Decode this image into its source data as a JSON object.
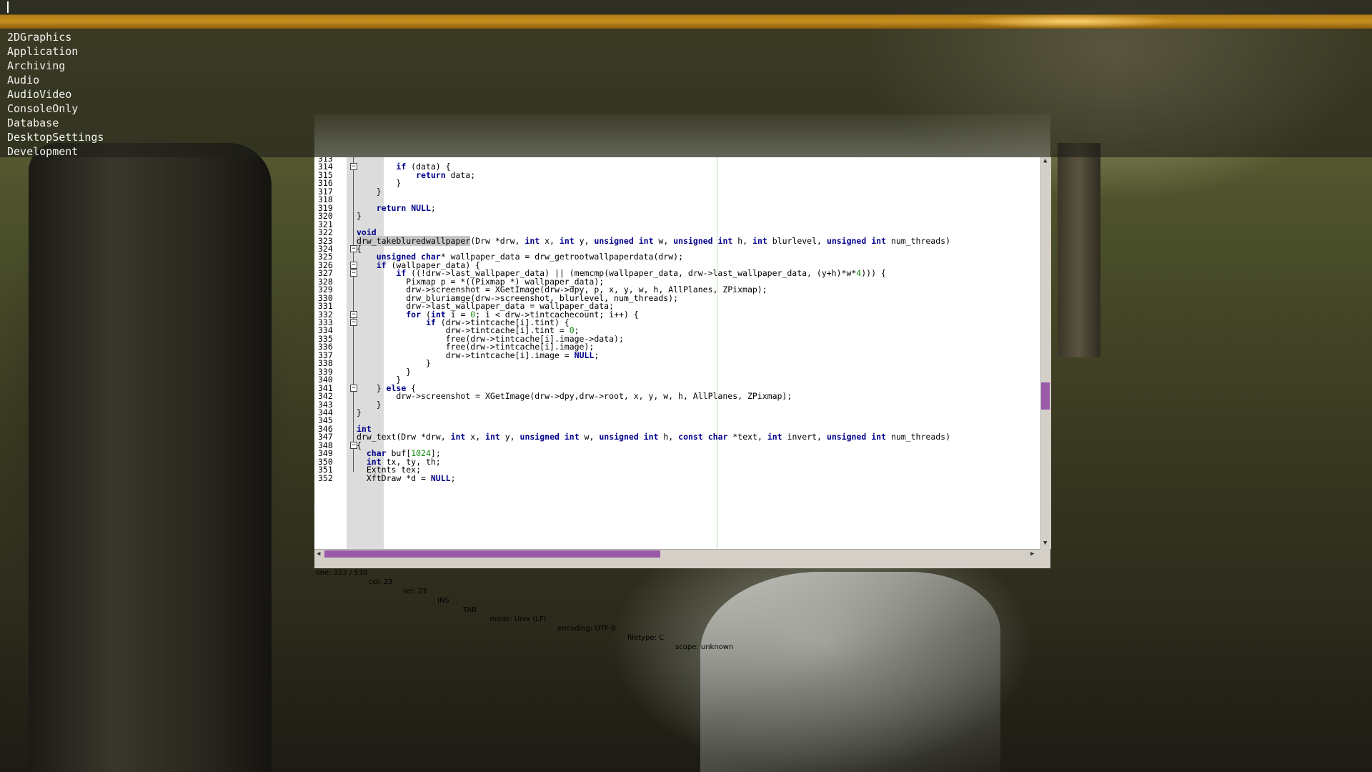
{
  "launcher": {
    "categories": [
      "2DGraphics",
      "Application",
      "Archiving",
      "Audio",
      "AudioVideo",
      "ConsoleOnly",
      "Database",
      "DesktopSettings",
      "Development"
    ]
  },
  "editor": {
    "lines": [
      {
        "n": "313",
        "t": ""
      },
      {
        "n": "314",
        "t": "        if (data) {"
      },
      {
        "n": "315",
        "t": "            return data;"
      },
      {
        "n": "316",
        "t": "        }"
      },
      {
        "n": "317",
        "t": "    }"
      },
      {
        "n": "318",
        "t": ""
      },
      {
        "n": "319",
        "t": "    return NULL;"
      },
      {
        "n": "320",
        "t": "}"
      },
      {
        "n": "321",
        "t": ""
      },
      {
        "n": "322",
        "t": "void"
      },
      {
        "n": "323",
        "t": "drw_takebluredwallpaper(Drw *drw, int x, int y, unsigned int w, unsigned int h, int blurlevel, unsigned int num_threads)"
      },
      {
        "n": "324",
        "t": "{"
      },
      {
        "n": "325",
        "t": "    unsigned char* wallpaper_data = drw_getrootwallpaperdata(drw);"
      },
      {
        "n": "326",
        "t": "    if (wallpaper_data) {"
      },
      {
        "n": "327",
        "t": "        if ((!drw->last_wallpaper_data) || (memcmp(wallpaper_data, drw->last_wallpaper_data, (y+h)*w*4))) {"
      },
      {
        "n": "328",
        "t": "          Pixmap p = *((Pixmap *) wallpaper_data);"
      },
      {
        "n": "329",
        "t": "          drw->screenshot = XGetImage(drw->dpy, p, x, y, w, h, AllPlanes, ZPixmap);"
      },
      {
        "n": "330",
        "t": "          drw_bluriamge(drw->screenshot, blurlevel, num_threads);"
      },
      {
        "n": "331",
        "t": "          drw->last_wallpaper_data = wallpaper_data;"
      },
      {
        "n": "332",
        "t": "          for (int i = 0; i < drw->tintcachecount; i++) {"
      },
      {
        "n": "333",
        "t": "              if (drw->tintcache[i].tint) {"
      },
      {
        "n": "334",
        "t": "                  drw->tintcache[i].tint = 0;"
      },
      {
        "n": "335",
        "t": "                  free(drw->tintcache[i].image->data);"
      },
      {
        "n": "336",
        "t": "                  free(drw->tintcache[i].image);"
      },
      {
        "n": "337",
        "t": "                  drw->tintcache[i].image = NULL;"
      },
      {
        "n": "338",
        "t": "              }"
      },
      {
        "n": "339",
        "t": "          }"
      },
      {
        "n": "340",
        "t": "        }"
      },
      {
        "n": "341",
        "t": "    } else {"
      },
      {
        "n": "342",
        "t": "        drw->screenshot = XGetImage(drw->dpy,drw->root, x, y, w, h, AllPlanes, ZPixmap);"
      },
      {
        "n": "343",
        "t": "    }"
      },
      {
        "n": "344",
        "t": "}"
      },
      {
        "n": "345",
        "t": ""
      },
      {
        "n": "346",
        "t": "int"
      },
      {
        "n": "347",
        "t": "drw_text(Drw *drw, int x, int y, unsigned int w, unsigned int h, const char *text, int invert, unsigned int num_threads)"
      },
      {
        "n": "348",
        "t": "{"
      },
      {
        "n": "349",
        "t": "  char buf[1024];"
      },
      {
        "n": "350",
        "t": "  int tx, ty, th;"
      },
      {
        "n": "351",
        "t": "  Extnts tex;"
      },
      {
        "n": "352",
        "t": "  XftDraw *d = NULL;"
      }
    ],
    "fold_markers": [
      "314",
      "324",
      "326",
      "327",
      "332",
      "333",
      "341",
      "348"
    ],
    "selected_word": "drw_takebluredwallpaper",
    "keywords": [
      "if",
      "return",
      "NULL",
      "void",
      "int",
      "unsigned",
      "char",
      "for",
      "else",
      "const"
    ]
  },
  "statusbar": {
    "line": "line: 323 / 530",
    "col": "col: 23",
    "sel": "sel: 23",
    "ins": "INS",
    "tab": "TAB",
    "mode": "mode: Unix (LF)",
    "encoding": "encoding: UTF-8",
    "filetype": "filetype: C",
    "scope": "scope: unknown"
  },
  "colors": {
    "accent_bar": "#c98f1e",
    "scroll_thumb": "#9a5aa8",
    "keyword": "#00008b",
    "number": "#0a8a0a"
  }
}
